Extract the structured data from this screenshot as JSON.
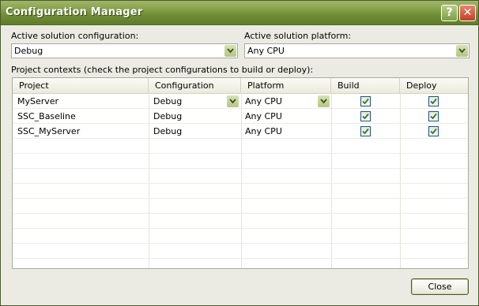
{
  "window": {
    "title": "Configuration Manager",
    "help_label": "?",
    "close_label": "✕"
  },
  "solution": {
    "config_label": "Active solution configuration:",
    "config_value": "Debug",
    "platform_label": "Active solution platform:",
    "platform_value": "Any CPU"
  },
  "contexts": {
    "label": "Project contexts (check the project configurations to build or deploy):",
    "columns": [
      "Project",
      "Configuration",
      "Platform",
      "Build",
      "Deploy"
    ],
    "rows": [
      {
        "project": "MyServer",
        "configuration": "Debug",
        "platform": "Any CPU",
        "build": true,
        "deploy": true
      },
      {
        "project": "SSC_Baseline",
        "configuration": "Debug",
        "platform": "Any CPU",
        "build": true,
        "deploy": true
      },
      {
        "project": "SSC_MyServer",
        "configuration": "Debug",
        "platform": "Any CPU",
        "build": true,
        "deploy": true
      }
    ]
  },
  "footer": {
    "close_button": "Close"
  },
  "colors": {
    "titlebar": "#7a9a3e",
    "check": "#2a7a2a"
  }
}
